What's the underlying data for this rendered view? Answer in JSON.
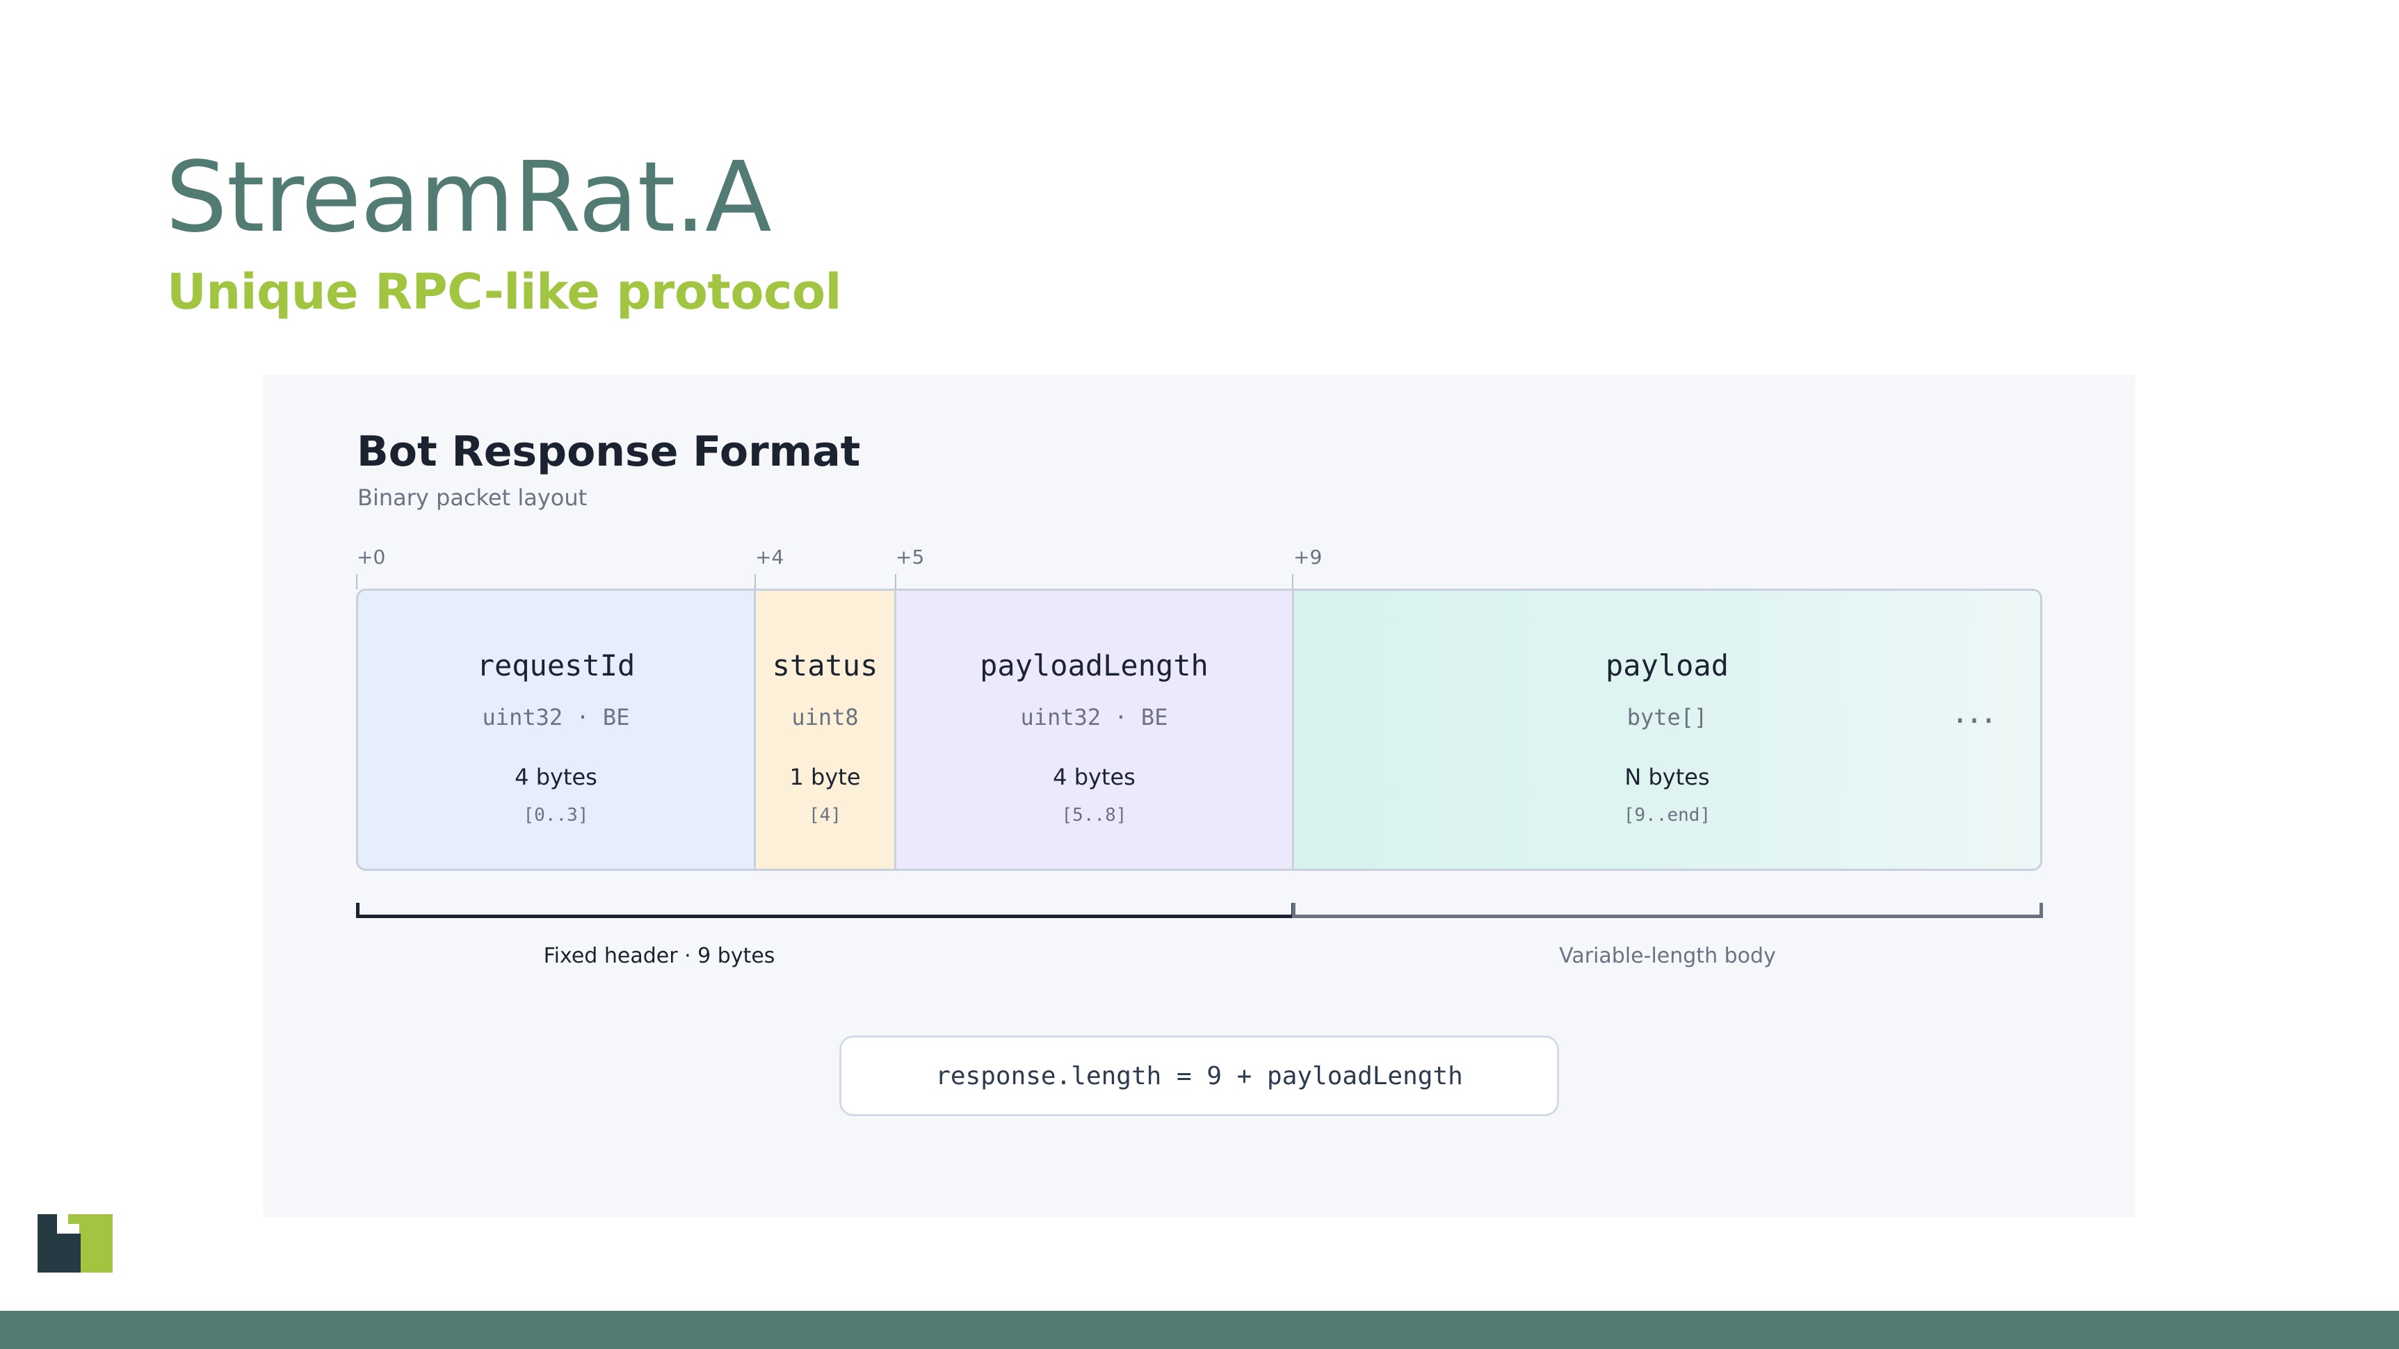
{
  "slide": {
    "title": "StreamRat.A",
    "subtitle": "Unique RPC-like protocol"
  },
  "diagram": {
    "title": "Bot Response Format",
    "subtitle": "Binary packet layout",
    "offsets": [
      "+0",
      "+4",
      "+5",
      "+9"
    ],
    "fields": [
      {
        "name": "requestId",
        "type": "uint32 · BE",
        "size": "4 bytes",
        "range": "[0..3]"
      },
      {
        "name": "status",
        "type": "uint8",
        "size": "1 byte",
        "range": "[4]"
      },
      {
        "name": "payloadLength",
        "type": "uint32 · BE",
        "size": "4 bytes",
        "range": "[5..8]"
      },
      {
        "name": "payload",
        "type": "byte[]",
        "size": "N bytes",
        "range": "[9..end]"
      }
    ],
    "ellipsis": "···",
    "groups": {
      "fixed_label": "Fixed header · 9 bytes",
      "variable_label": "Variable-length body"
    },
    "formula": "response.length = 9 + payloadLength"
  },
  "colors": {
    "brand_teal": "#527b73",
    "brand_green": "#a1c540",
    "logo_dark": "#263a44"
  },
  "icons": {
    "logo": "company-logo"
  }
}
